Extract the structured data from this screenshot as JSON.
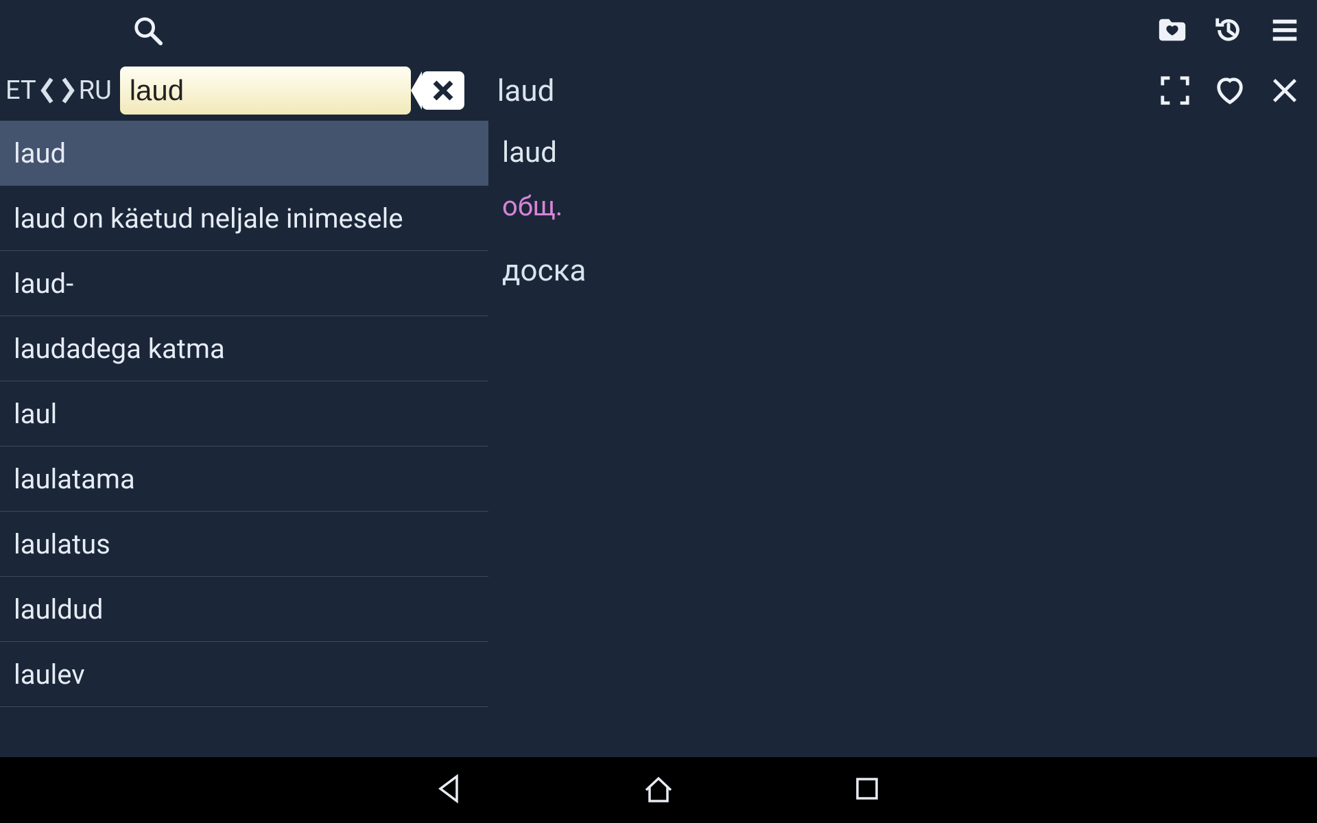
{
  "lang": {
    "from": "ET",
    "to": "RU"
  },
  "search": {
    "value": "laud"
  },
  "headword": "laud",
  "results": [
    "laud",
    "laud on käetud neljale inimesele",
    "laud-",
    "laudadega katma",
    "laul",
    "laulatama",
    "laulatus",
    "lauldud",
    "laulev"
  ],
  "selected_index": 0,
  "definition": {
    "head": "laud",
    "tag": "общ.",
    "body": "доска"
  }
}
